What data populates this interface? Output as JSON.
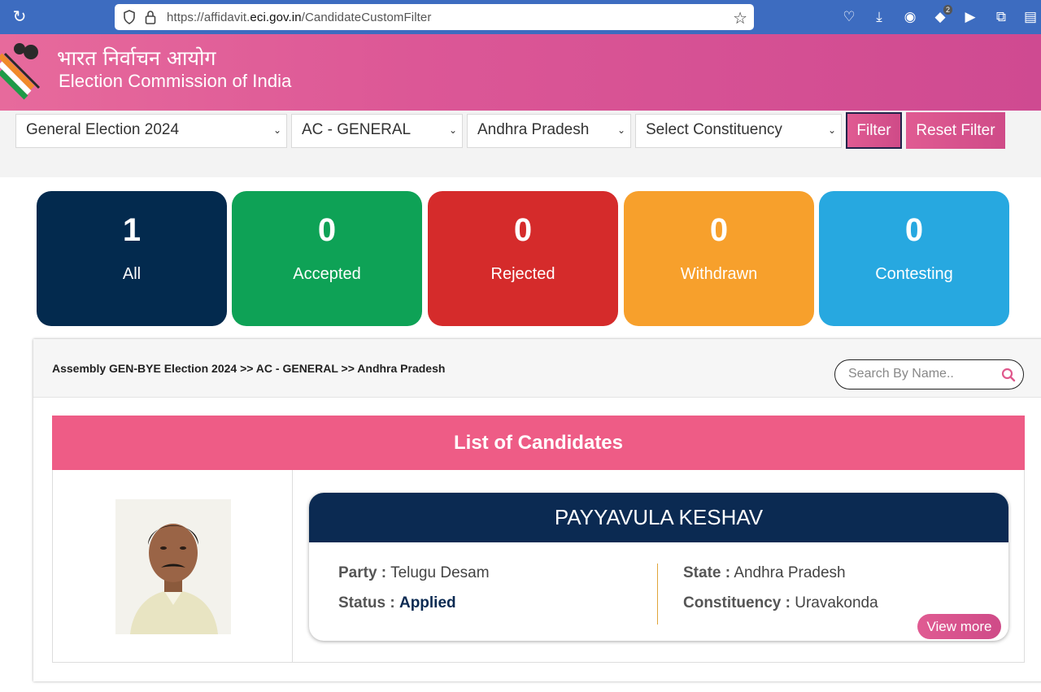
{
  "browser": {
    "url_prefix": "https://affidavit.",
    "url_domain": "eci.gov.in",
    "url_path": "/CandidateCustomFilter",
    "extension_badge": "2"
  },
  "header": {
    "org_hindi": "भारत निर्वाचन आयोग",
    "org_english": "Election Commission of India"
  },
  "filters": {
    "election": "General Election 2024",
    "type": "AC - GENERAL",
    "state": "Andhra Pradesh",
    "constituency": "Select Constituency",
    "filter_label": "Filter",
    "reset_label": "Reset Filter"
  },
  "stats": [
    {
      "count": "1",
      "label": "All",
      "color": "#032a4e"
    },
    {
      "count": "0",
      "label": "Accepted",
      "color": "#0ea256"
    },
    {
      "count": "0",
      "label": "Rejected",
      "color": "#d52b2b"
    },
    {
      "count": "0",
      "label": "Withdrawn",
      "color": "#f7a02c"
    },
    {
      "count": "0",
      "label": "Contesting",
      "color": "#27a8e0"
    }
  ],
  "results": {
    "breadcrumb": "Assembly GEN-BYE Election 2024 >> AC - GENERAL >> Andhra Pradesh",
    "search_placeholder": "Search By Name..",
    "list_title": "List of Candidates"
  },
  "candidate": {
    "name": "PAYYAVULA KESHAV",
    "party_label": "Party :",
    "party": "Telugu Desam",
    "status_label": "Status :",
    "status": "Applied",
    "state_label": "State :",
    "state": "Andhra Pradesh",
    "constituency_label": "Constituency :",
    "constituency": "Uravakonda",
    "view_more": "View more"
  }
}
